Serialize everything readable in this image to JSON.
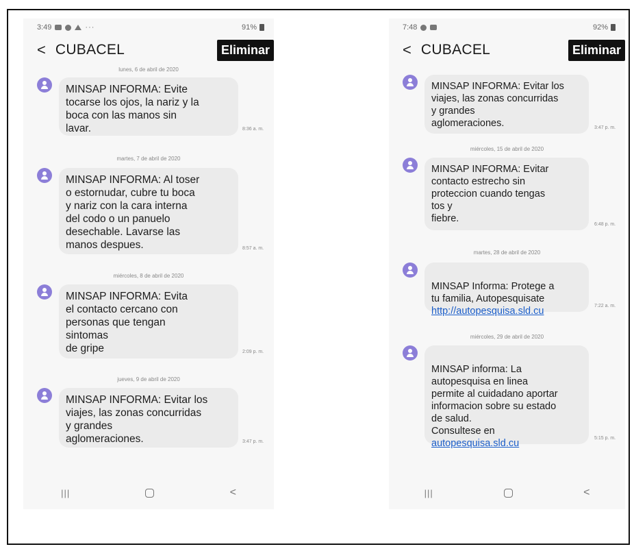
{
  "left_phone": {
    "status": {
      "time": "3:49",
      "dots": "···",
      "signal": "91%"
    },
    "header": {
      "title": "CUBACEL",
      "delete_label": "Eliminar"
    },
    "dates": [
      "lunes, 6 de abril de 2020",
      "martes, 7 de abril de 2020",
      "miércoles, 8 de abril de 2020",
      "jueves, 9 de abril de 2020"
    ],
    "messages": [
      {
        "text": "MINSAP INFORMA: Evite\ntocarse los ojos, la nariz y la\nboca con las manos sin\nlavar.",
        "time": "8:36 a. m."
      },
      {
        "text": "MINSAP INFORMA: Al toser\no estornudar, cubre tu boca\ny nariz con la cara interna\ndel codo o un panuelo\ndesechable. Lavarse las\nmanos despues.",
        "time": "8:57 a. m."
      },
      {
        "text": "MINSAP INFORMA: Evita\nel contacto cercano con\npersonas que tengan\nsintomas\nde gripe",
        "time": "2:09 p. m."
      },
      {
        "text": "MINSAP INFORMA: Evitar los\nviajes, las zonas concurridas\ny grandes\naglomeraciones.",
        "time": "3:47 p. m."
      }
    ]
  },
  "right_phone": {
    "status": {
      "time": "7:48",
      "signal": "92%"
    },
    "header": {
      "title": "CUBACEL",
      "delete_label": "Eliminar"
    },
    "dates": [
      "miércoles, 15 de abril de 2020",
      "martes, 28 de abril de 2020",
      "miércoles, 29 de abril de 2020"
    ],
    "messages": [
      {
        "text": "MINSAP INFORMA: Evitar los\nviajes, las zonas concurridas\ny grandes\naglomeraciones.",
        "time": "3:47 p. m."
      },
      {
        "text": "MINSAP INFORMA: Evitar\ncontacto estrecho sin\nproteccion cuando tengas\ntos y\nfiebre.",
        "time": "6:48 p. m."
      },
      {
        "text": "MINSAP Informa: Protege a\ntu familia, Autopesquisate",
        "link": "http://autopesquisa.sld.cu",
        "time": "7:22 a. m."
      },
      {
        "text": "MINSAP informa: La\nautopesquisa en linea\npermite al cuidadano aportar\ninformacion sobre su estado\nde salud.\nConsultese en",
        "link": "autopesquisa.sld.cu",
        "time": "5:15 p. m."
      }
    ]
  },
  "colors": {
    "avatar": "#8c7ed8",
    "bubble": "#ebebeb",
    "link": "#1a5dc8",
    "delete_button": "#111111"
  },
  "icons": [
    "back-chevron-icon",
    "contact-avatar-icon",
    "recent-apps-icon",
    "home-icon",
    "nav-back-icon",
    "battery-icon"
  ]
}
